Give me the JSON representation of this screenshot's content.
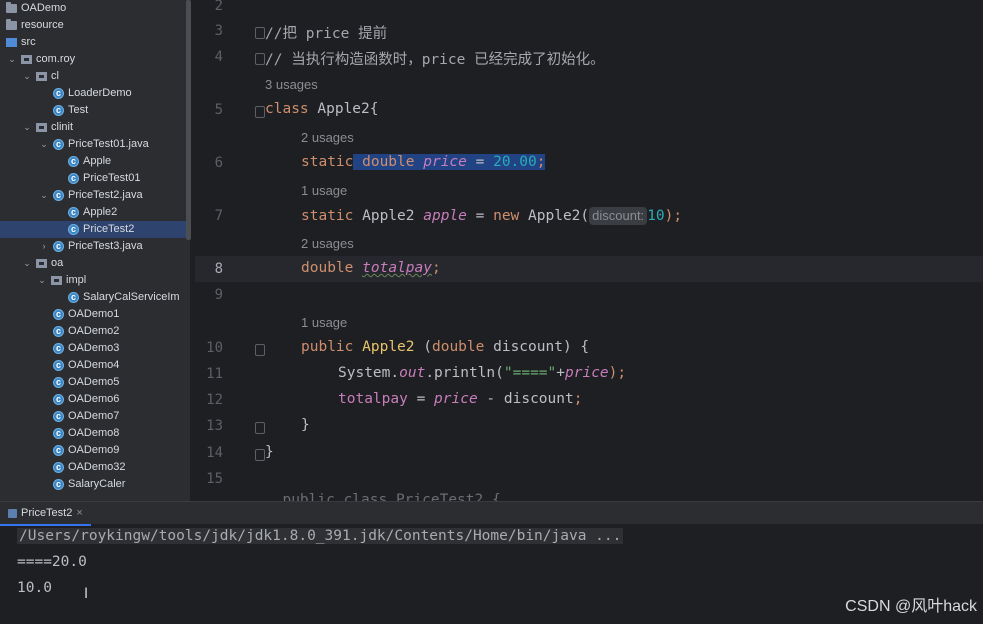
{
  "tree": {
    "items": [
      {
        "label": "OADemo",
        "icon": "module-folder-icon",
        "depth": 0,
        "arrow": ""
      },
      {
        "label": "resource",
        "icon": "folder-icon",
        "depth": 0,
        "arrow": ""
      },
      {
        "label": "src",
        "icon": "source-folder-icon",
        "depth": 0,
        "arrow": ""
      },
      {
        "label": "com.roy",
        "icon": "package-icon",
        "depth": 1,
        "arrow": "v"
      },
      {
        "label": "cl",
        "icon": "package-icon",
        "depth": 2,
        "arrow": "v"
      },
      {
        "label": "LoaderDemo",
        "icon": "class-icon",
        "depth": 3,
        "arrow": ""
      },
      {
        "label": "Test",
        "icon": "class-icon",
        "depth": 3,
        "arrow": ""
      },
      {
        "label": "clinit",
        "icon": "package-icon",
        "depth": 2,
        "arrow": "v"
      },
      {
        "label": "PriceTest01.java",
        "icon": "class-icon",
        "depth": 3,
        "arrow": "v"
      },
      {
        "label": "Apple",
        "icon": "class-icon",
        "depth": 4,
        "arrow": ""
      },
      {
        "label": "PriceTest01",
        "icon": "class-icon",
        "depth": 4,
        "arrow": ""
      },
      {
        "label": "PriceTest2.java",
        "icon": "class-icon",
        "depth": 3,
        "arrow": "v"
      },
      {
        "label": "Apple2",
        "icon": "class-icon",
        "depth": 4,
        "arrow": ""
      },
      {
        "label": "PriceTest2",
        "icon": "class-icon",
        "depth": 4,
        "arrow": "",
        "selected": true
      },
      {
        "label": "PriceTest3.java",
        "icon": "class-icon",
        "depth": 3,
        "arrow": ">"
      },
      {
        "label": "oa",
        "icon": "package-icon",
        "depth": 2,
        "arrow": "v"
      },
      {
        "label": "impl",
        "icon": "package-icon",
        "depth": 3,
        "arrow": "v"
      },
      {
        "label": "SalaryCalServiceIm",
        "icon": "class-icon",
        "depth": 4,
        "arrow": ""
      },
      {
        "label": "OADemo1",
        "icon": "class-icon",
        "depth": 3,
        "arrow": ""
      },
      {
        "label": "OADemo2",
        "icon": "class-icon",
        "depth": 3,
        "arrow": ""
      },
      {
        "label": "OADemo3",
        "icon": "class-icon",
        "depth": 3,
        "arrow": ""
      },
      {
        "label": "OADemo4",
        "icon": "class-icon",
        "depth": 3,
        "arrow": ""
      },
      {
        "label": "OADemo5",
        "icon": "class-icon",
        "depth": 3,
        "arrow": ""
      },
      {
        "label": "OADemo6",
        "icon": "class-icon",
        "depth": 3,
        "arrow": ""
      },
      {
        "label": "OADemo7",
        "icon": "class-icon",
        "depth": 3,
        "arrow": ""
      },
      {
        "label": "OADemo8",
        "icon": "class-icon",
        "depth": 3,
        "arrow": ""
      },
      {
        "label": "OADemo9",
        "icon": "class-icon",
        "depth": 3,
        "arrow": ""
      },
      {
        "label": "OADemo32",
        "icon": "class-icon",
        "depth": 3,
        "arrow": ""
      },
      {
        "label": "SalaryCaler",
        "icon": "class-icon",
        "depth": 3,
        "arrow": ""
      }
    ]
  },
  "editor": {
    "line_numbers": [
      "2",
      "3",
      "4",
      "5",
      "6",
      "7",
      "8",
      "9",
      "10",
      "11",
      "12",
      "13",
      "14",
      "15"
    ],
    "current_line": "8",
    "comment1": "//把 price 提前",
    "comment2": "// 当执行构造函数时，price 已经完成了初始化。",
    "usages_class": "3 usages",
    "class_kw": "class",
    "class_name": " Apple2{",
    "usages_price": "2 usages",
    "static1": "static",
    "double1": " double ",
    "price_field": "price",
    "price_assign": " = ",
    "price_value": "20.00",
    "semi1": ";",
    "usages_apple": "1 usage",
    "static2": "static",
    "apple_type": " Apple2 ",
    "apple_field": "apple",
    "apple_eq": " = ",
    "new_kw": "new",
    "apple_ctor": " Apple2(",
    "hint_label": "discount:",
    "apple_arg": "10",
    "apple_end": ");",
    "usages_total": "2 usages",
    "double2": "double",
    "totalpay_field": "totalpay",
    "semi2": ";",
    "usages_ctor": "1 usage",
    "public_kw": "public",
    "ctor_name": "Apple2",
    "ctor_params_open": " (",
    "ctor_param_type": "double",
    "ctor_params_rest": " discount) {",
    "sys": "System.",
    "out_field": "out",
    "println": ".println(",
    "str_lit": "\"====\"",
    "plus": "+",
    "price_ref": "price",
    "println_end": ");",
    "totalpay_ref": "totalpay",
    "assign_rest": " = ",
    "price_ref2": "price",
    "minus_disc": " - discount",
    "semi3": ";",
    "close_brace_inner": "}",
    "close_brace_outer": "}",
    "bottom_cut": "  public class PriceTest2 {"
  },
  "run": {
    "tab_label": "PriceTest2",
    "tab_close": "×",
    "console_lines": [
      "/Users/roykingw/tools/jdk/jdk1.8.0_391.jdk/Contents/Home/bin/java ...",
      "====20.0",
      "10.0"
    ]
  },
  "watermark": "CSDN @风叶hack",
  "colors": {
    "background": "#1e1f22",
    "keyword": "#cf8e6d",
    "field": "#c77dbb",
    "number": "#2aacb8",
    "string": "#6aab73",
    "selection": "#214283"
  }
}
